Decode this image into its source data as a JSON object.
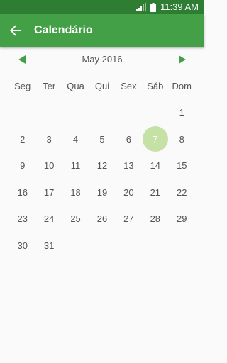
{
  "status_bar": {
    "time": "11:39 AM"
  },
  "app_bar": {
    "title": "Calendário"
  },
  "calendar": {
    "month_label": "May 2016",
    "weekdays": [
      "Seg",
      "Ter",
      "Qua",
      "Qui",
      "Sex",
      "Sáb",
      "Dom"
    ],
    "leading_blanks": 6,
    "days": [
      "1",
      "2",
      "3",
      "4",
      "5",
      "6",
      "7",
      "8",
      "9",
      "10",
      "11",
      "12",
      "13",
      "14",
      "15",
      "16",
      "17",
      "18",
      "19",
      "20",
      "21",
      "22",
      "23",
      "24",
      "25",
      "26",
      "27",
      "28",
      "29",
      "30",
      "31"
    ],
    "selected_day": "7"
  },
  "colors": {
    "status_bar": "#2e7d32",
    "app_bar": "#43a047",
    "selected_circle": "#c5e1a5",
    "nav_arrow": "#43a047",
    "text": "#555555"
  },
  "icons": {
    "back": "arrow-left-icon",
    "prev": "triangle-left-icon",
    "next": "triangle-right-icon",
    "signal": "signal-icon",
    "battery": "battery-icon"
  }
}
